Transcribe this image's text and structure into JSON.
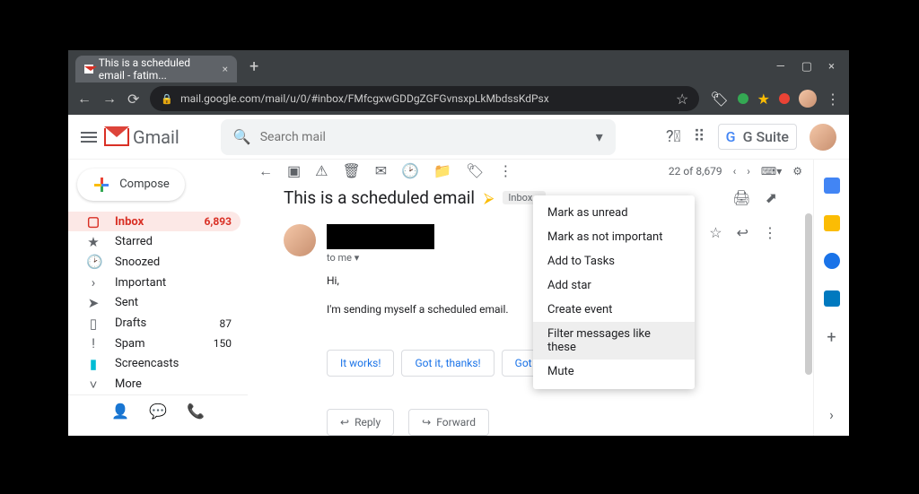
{
  "tab": {
    "title": "This is a scheduled email - fatim..."
  },
  "url": "mail.google.com/mail/u/0/#inbox/FMfcgxwGDDgZGFGvnsxpLkMbdssKdPsx",
  "app": {
    "name": "Gmail",
    "suite": "G Suite"
  },
  "search": {
    "placeholder": "Search mail"
  },
  "compose_label": "Compose",
  "sidebar": {
    "items": [
      {
        "label": "Inbox",
        "count": "6,893",
        "icon": "▢"
      },
      {
        "label": "Starred",
        "count": "",
        "icon": "★"
      },
      {
        "label": "Snoozed",
        "count": "",
        "icon": "🕑"
      },
      {
        "label": "Important",
        "count": "",
        "icon": "›"
      },
      {
        "label": "Sent",
        "count": "",
        "icon": "➤"
      },
      {
        "label": "Drafts",
        "count": "87",
        "icon": "▯"
      },
      {
        "label": "Spam",
        "count": "150",
        "icon": "!"
      },
      {
        "label": "Screencasts",
        "count": "",
        "icon": "▮"
      },
      {
        "label": "More",
        "count": "",
        "icon": "˅"
      }
    ]
  },
  "toolbar": {
    "position": "22 of 8,679"
  },
  "message": {
    "subject": "This is a scheduled email",
    "label": "Inbox ×",
    "to": "to me ▾",
    "body1": "Hi,",
    "body2": "I'm sending myself a scheduled email."
  },
  "smart_replies": [
    "It works!",
    "Got it, thanks!",
    "Got it!"
  ],
  "reply_actions": {
    "reply": "Reply",
    "forward": "Forward"
  },
  "context_menu": [
    "Mark as unread",
    "Mark as not important",
    "Add to Tasks",
    "Add star",
    "Create event",
    "Filter messages like these",
    "Mute"
  ],
  "rightbar_colors": [
    "#4285f4",
    "#fbbc04",
    "#1a73e8",
    "#1a73e8"
  ]
}
